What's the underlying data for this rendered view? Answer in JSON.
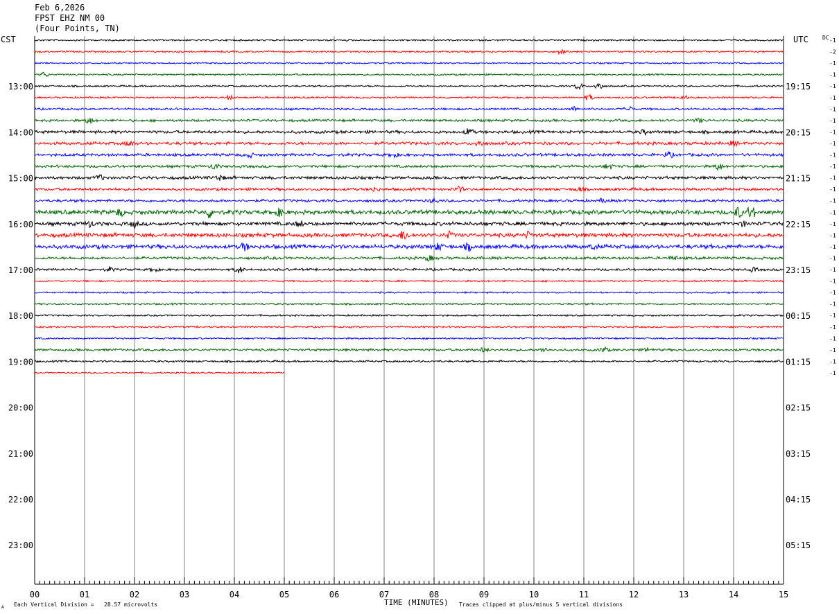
{
  "header": {
    "date": "Feb 6,2026",
    "station": "FPST EHZ NM 00",
    "location": "(Four Points, TN)"
  },
  "labels": {
    "left_zone": "CST",
    "right_zone": "UTC",
    "dc": "DC",
    "x_axis_title": "TIME (MINUTES)",
    "vertical_division": "Each Vertical Division =   28.57 microvolts",
    "clip_note": "Traces clipped at plus/minus 5 vertical divisions",
    "corner_mark": "A"
  },
  "chart_data": {
    "type": "line",
    "x_ticks": [
      "00",
      "01",
      "02",
      "03",
      "04",
      "05",
      "06",
      "07",
      "08",
      "09",
      "10",
      "11",
      "12",
      "13",
      "14",
      "15"
    ],
    "xlim": [
      0,
      15
    ],
    "rows_total": 48,
    "left_hour_labels": [
      "13:00",
      "14:00",
      "15:00",
      "16:00",
      "17:00",
      "18:00",
      "19:00",
      "20:00",
      "21:00",
      "22:00",
      "23:00"
    ],
    "right_hour_labels": [
      "19:15",
      "20:15",
      "21:15",
      "22:15",
      "23:15",
      "00:15",
      "01:15",
      "02:15",
      "03:15",
      "04:15",
      "05:15"
    ],
    "trace_colors": [
      "#000000",
      "#ff0000",
      "#0000ff",
      "#006400"
    ],
    "traces": [
      {
        "dc": "-1",
        "amp": 1.0,
        "end_minute": 15,
        "events": []
      },
      {
        "dc": "-2",
        "amp": 1.0,
        "end_minute": 15,
        "events": [
          {
            "t": 10.55,
            "a": 4
          }
        ]
      },
      {
        "dc": "-1",
        "amp": 0.9,
        "end_minute": 15,
        "events": []
      },
      {
        "dc": "-1",
        "amp": 1.0,
        "end_minute": 15,
        "events": [
          {
            "t": 0.2,
            "a": 4
          }
        ]
      },
      {
        "dc": "-1",
        "amp": 1.0,
        "end_minute": 15,
        "events": [
          {
            "t": 10.9,
            "a": 5
          },
          {
            "t": 11.3,
            "a": 6
          }
        ]
      },
      {
        "dc": "-1",
        "amp": 1.0,
        "end_minute": 15,
        "events": [
          {
            "t": 3.9,
            "a": 3
          },
          {
            "t": 11.1,
            "a": 4
          },
          {
            "t": 13.0,
            "a": 3
          }
        ]
      },
      {
        "dc": "-1",
        "amp": 1.2,
        "end_minute": 15,
        "events": [
          {
            "t": 10.8,
            "a": 3
          },
          {
            "t": 11.9,
            "a": 4
          }
        ]
      },
      {
        "dc": "-1",
        "amp": 1.5,
        "end_minute": 15,
        "events": [
          {
            "t": 1.1,
            "a": 4
          },
          {
            "t": 13.3,
            "a": 3
          }
        ]
      },
      {
        "dc": "-1",
        "amp": 1.8,
        "end_minute": 15,
        "events": [
          {
            "t": 8.7,
            "a": 5
          },
          {
            "t": 12.2,
            "a": 3
          }
        ]
      },
      {
        "dc": "-1",
        "amp": 1.8,
        "end_minute": 15,
        "events": [
          {
            "t": 1.9,
            "a": 4
          },
          {
            "t": 8.9,
            "a": 4
          },
          {
            "t": 14.0,
            "a": 3
          }
        ]
      },
      {
        "dc": "-1",
        "amp": 1.7,
        "end_minute": 15,
        "events": [
          {
            "t": 4.3,
            "a": 3
          },
          {
            "t": 7.2,
            "a": 3
          },
          {
            "t": 12.7,
            "a": 4
          }
        ]
      },
      {
        "dc": "-1",
        "amp": 1.6,
        "end_minute": 15,
        "events": [
          {
            "t": 3.6,
            "a": 4
          },
          {
            "t": 11.5,
            "a": 4
          },
          {
            "t": 13.7,
            "a": 5
          }
        ]
      },
      {
        "dc": "-1",
        "amp": 1.8,
        "end_minute": 15,
        "events": [
          {
            "t": 1.3,
            "a": 4
          },
          {
            "t": 3.7,
            "a": 4
          }
        ]
      },
      {
        "dc": "-1",
        "amp": 1.6,
        "end_minute": 15,
        "events": [
          {
            "t": 6.8,
            "a": 3
          },
          {
            "t": 8.5,
            "a": 4
          },
          {
            "t": 10.9,
            "a": 3
          }
        ]
      },
      {
        "dc": "-1",
        "amp": 1.6,
        "end_minute": 15,
        "events": [
          {
            "t": 8.0,
            "a": 3
          },
          {
            "t": 11.4,
            "a": 3
          }
        ]
      },
      {
        "dc": "-1",
        "amp": 2.6,
        "end_minute": 15,
        "events": [
          {
            "t": 1.7,
            "a": 5
          },
          {
            "t": 3.5,
            "a": 7
          },
          {
            "t": 4.9,
            "a": 5
          },
          {
            "t": 14.1,
            "a": 7
          },
          {
            "t": 14.35,
            "a": 9
          }
        ]
      },
      {
        "dc": "-1",
        "amp": 2.2,
        "end_minute": 15,
        "events": [
          {
            "t": 1.1,
            "a": 4
          },
          {
            "t": 2.0,
            "a": 4
          },
          {
            "t": 5.3,
            "a": 4
          },
          {
            "t": 14.2,
            "a": 3
          }
        ]
      },
      {
        "dc": "-1",
        "amp": 2.4,
        "end_minute": 15,
        "events": [
          {
            "t": 7.4,
            "a": 7
          },
          {
            "t": 8.3,
            "a": 4
          },
          {
            "t": 9.9,
            "a": 4
          }
        ]
      },
      {
        "dc": "-1",
        "amp": 2.4,
        "end_minute": 15,
        "events": [
          {
            "t": 4.2,
            "a": 5
          },
          {
            "t": 8.1,
            "a": 5
          },
          {
            "t": 8.7,
            "a": 4
          },
          {
            "t": 11.2,
            "a": 3
          }
        ]
      },
      {
        "dc": "-1",
        "amp": 1.6,
        "end_minute": 15,
        "events": [
          {
            "t": 7.9,
            "a": 4
          },
          {
            "t": 12.8,
            "a": 3
          }
        ]
      },
      {
        "dc": "-1",
        "amp": 1.4,
        "end_minute": 15,
        "events": [
          {
            "t": 1.5,
            "a": 3
          },
          {
            "t": 2.4,
            "a": 3
          },
          {
            "t": 4.1,
            "a": 5
          },
          {
            "t": 14.4,
            "a": 3
          }
        ]
      },
      {
        "dc": "-1",
        "amp": 1.0,
        "end_minute": 15,
        "events": []
      },
      {
        "dc": "-1",
        "amp": 1.0,
        "end_minute": 15,
        "events": []
      },
      {
        "dc": "-1",
        "amp": 1.1,
        "end_minute": 15,
        "events": []
      },
      {
        "dc": "-1",
        "amp": 1.0,
        "end_minute": 15,
        "events": []
      },
      {
        "dc": "-1",
        "amp": 1.0,
        "end_minute": 15,
        "events": []
      },
      {
        "dc": "-1",
        "amp": 1.0,
        "end_minute": 15,
        "events": []
      },
      {
        "dc": "-1",
        "amp": 1.4,
        "end_minute": 15,
        "events": [
          {
            "t": 9.0,
            "a": 3
          },
          {
            "t": 10.2,
            "a": 3
          },
          {
            "t": 11.4,
            "a": 4
          },
          {
            "t": 12.3,
            "a": 3
          }
        ]
      },
      {
        "dc": "-1",
        "amp": 1.2,
        "end_minute": 15,
        "events": []
      },
      {
        "dc": "-1",
        "amp": 0.9,
        "end_minute": 5,
        "events": []
      }
    ]
  }
}
